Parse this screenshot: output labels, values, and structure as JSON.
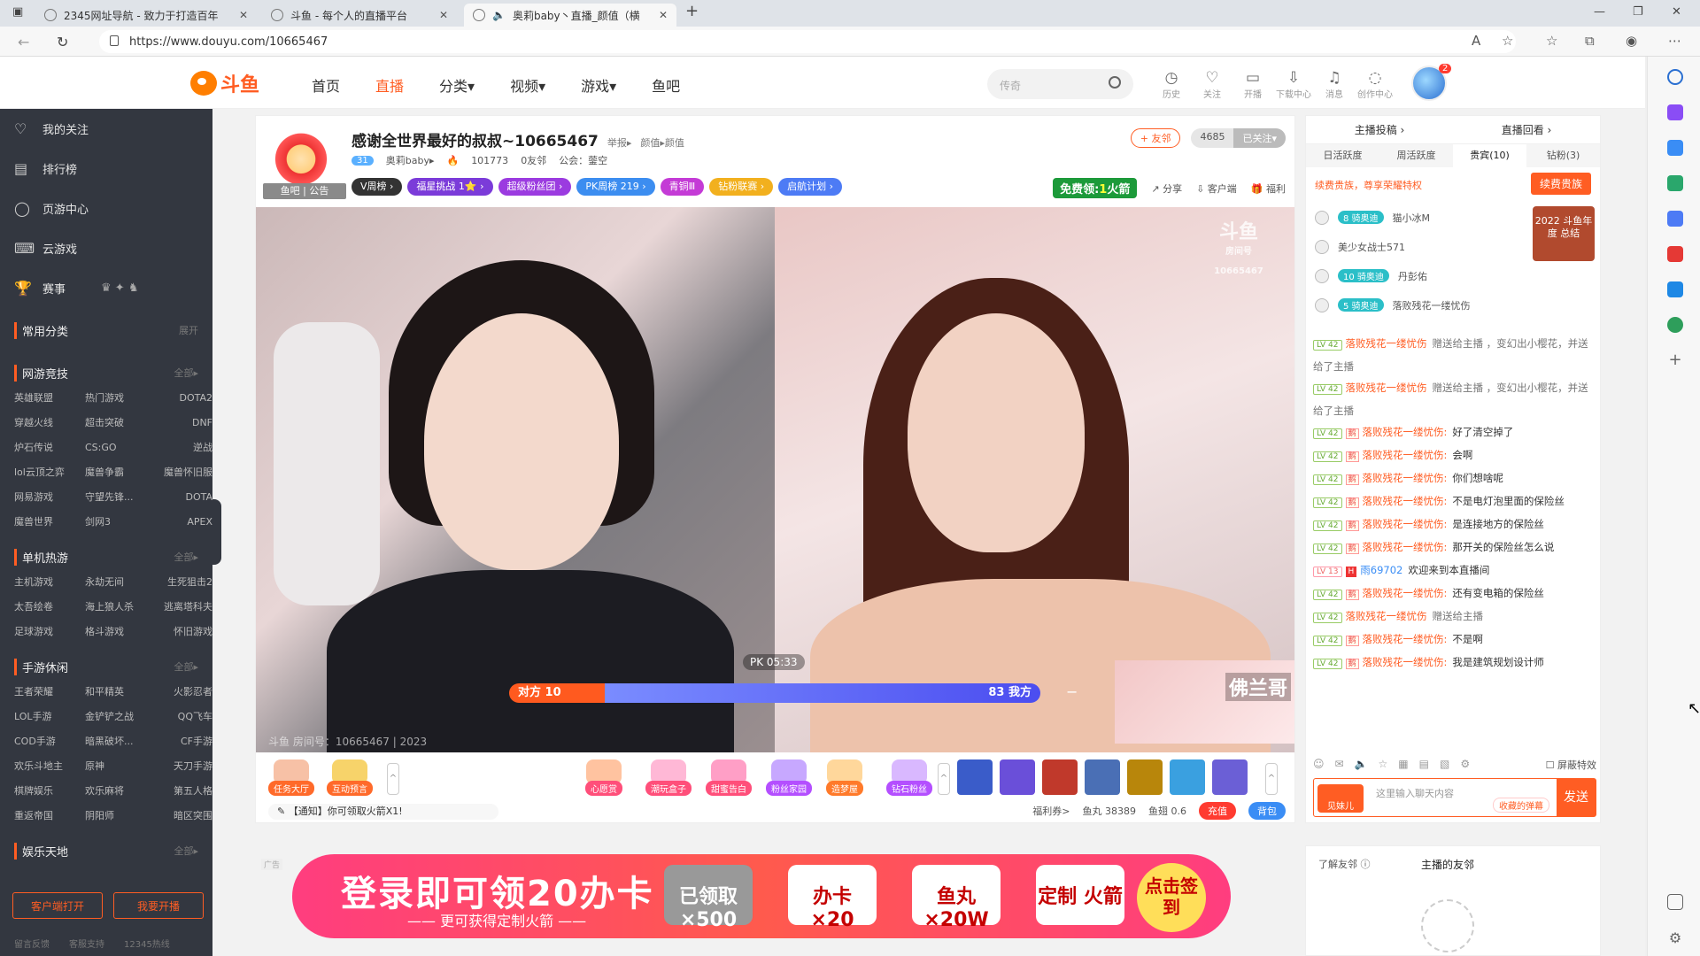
{
  "browser": {
    "tabs": [
      {
        "title": "2345网址导航 - 致力于打造百年",
        "active": false
      },
      {
        "title": "斗鱼 - 每个人的直播平台",
        "active": false
      },
      {
        "title": "奥莉baby丶直播_颜值（横",
        "active": true
      }
    ],
    "url": "https://www.douyu.com/10665467"
  },
  "header": {
    "logo_text": "斗鱼",
    "nav": [
      "首页",
      "直播",
      "分类▾",
      "视频▾",
      "游戏▾",
      "鱼吧"
    ],
    "nav_active": 1,
    "search_placeholder": "传奇",
    "icons": [
      {
        "icon": "history-icon",
        "label": "历史"
      },
      {
        "icon": "heart-icon",
        "label": "关注"
      },
      {
        "icon": "camera-icon",
        "label": "开播"
      },
      {
        "icon": "download-icon",
        "label": "下载中心"
      },
      {
        "icon": "bell-icon",
        "label": "消息"
      },
      {
        "icon": "bulb-icon",
        "label": "创作中心"
      }
    ],
    "avatar_badge": "2"
  },
  "sidebar": {
    "items": [
      {
        "icon": "heart-icon",
        "label": "我的关注"
      },
      {
        "icon": "rank-icon",
        "label": "排行榜"
      },
      {
        "icon": "game-center-icon",
        "label": "页游中心"
      },
      {
        "icon": "cloud-game-icon",
        "label": "云游戏"
      },
      {
        "icon": "trophy-icon",
        "label": "赛事"
      }
    ],
    "common": {
      "title": "常用分类",
      "more": "展开"
    },
    "sections": [
      {
        "title": "网游竞技",
        "more": "全部▸",
        "games": [
          "英雄联盟",
          "热门游戏",
          "DOTA2",
          "穿越火线",
          "超击突破",
          "DNF",
          "炉石传说",
          "CS:GO",
          "逆战",
          "lol云顶之弈",
          "魔兽争霸",
          "魔兽怀旧服",
          "网易游戏",
          "守望先锋...",
          "DOTA",
          "魔兽世界",
          "剑网3",
          "APEX"
        ]
      },
      {
        "title": "单机热游",
        "more": "全部▸",
        "games": [
          "主机游戏",
          "永劫无间",
          "生死狙击2",
          "太吾绘卷",
          "海上狼人杀",
          "逃离塔科夫",
          "足球游戏",
          "格斗游戏",
          "怀旧游戏"
        ]
      },
      {
        "title": "手游休闲",
        "more": "全部▸",
        "games": [
          "王者荣耀",
          "和平精英",
          "火影忍者",
          "LOL手游",
          "金铲铲之战",
          "QQ飞车",
          "COD手游",
          "暗黑破坏...",
          "CF手游",
          "欢乐斗地主",
          "原神",
          "天刀手游",
          "棋牌娱乐",
          "欢乐麻将",
          "第五人格",
          "重返帝国",
          "阴阳师",
          "暗区突围"
        ]
      },
      {
        "title": "娱乐天地",
        "more": "全部▸",
        "games": []
      }
    ],
    "buttons": [
      "客户端打开",
      "我要开播"
    ],
    "footer": [
      "留言反馈",
      "客服支持",
      "12345热线"
    ]
  },
  "room": {
    "avatar_label": "鱼吧 | 公告",
    "title": "感谢全世界最好的叔叔~10665467",
    "report": "举报▸",
    "category": "颜值▸颜值",
    "level": "31",
    "anchor": "奥莉baby▸",
    "hot": "101773",
    "neighbors": "0友邻",
    "guild": "公会：蓥空",
    "tags": [
      {
        "text": "V周榜 ›",
        "color": "#333333"
      },
      {
        "text": "福星挑战 1⭐ ›",
        "color": "#7b3bd9"
      },
      {
        "text": "超级粉丝团 ›",
        "color": "#9b3be0"
      },
      {
        "text": "PK周榜 219 ›",
        "color": "#3c8df0"
      },
      {
        "text": "青铜Ⅲ",
        "color": "#c43bd6"
      },
      {
        "text": "钻粉联赛 ›",
        "color": "#f2b01e"
      },
      {
        "text": "启航计划 ›",
        "color": "#4d7bf5"
      }
    ],
    "fan_btn": "+ 友邻",
    "follow_count": "4685",
    "followed": "已关注▾",
    "free_label": "免费领:",
    "free_num": "1",
    "free_unit": "火箭",
    "share": "分享",
    "client": "客户端",
    "welfare": "福利"
  },
  "video": {
    "watermark_main": "斗鱼",
    "watermark_sub": "房间号",
    "watermark_id": "10665467",
    "pk_time": "PK 05:33",
    "pk_left": "对方 10",
    "pk_right": "83 我方",
    "pk_minus": "−",
    "overlay_name": "佛兰哥",
    "room_no": "斗鱼 房间号：10665467 | 2023"
  },
  "gifts": {
    "left": [
      {
        "label": "任务大厅",
        "color": "#ff6a2a"
      },
      {
        "label": "互动预言",
        "color": "#ff6a2a"
      }
    ],
    "right": [
      {
        "label": "心愿赏",
        "color": "#ff4f7a"
      },
      {
        "label": "潮玩盒子",
        "color": "#ff4f7a"
      },
      {
        "label": "甜蜜告白",
        "color": "#ff4f7a"
      },
      {
        "label": "粉丝家园",
        "color": "#b44fff"
      },
      {
        "label": "造梦屋",
        "color": "#ff7a2a"
      },
      {
        "label": "钻石粉丝",
        "color": "#b44fff"
      }
    ],
    "notice": "【通知】你可领取火箭X1!",
    "ticket": "福利券>",
    "fish_ball": "鱼丸 38389",
    "fish_fin": "鱼翅 0.6",
    "recharge": "充值",
    "bag": "背包"
  },
  "banner": {
    "title": "登录即可领20办卡",
    "subtitle": "—— 更可获得定制火箭 ——",
    "cards": [
      "已领取 ×500",
      "办卡 ×20",
      "鱼丸 ×20W",
      "定制 火箭"
    ],
    "sign": "点击签到",
    "ad": "广告"
  },
  "chat": {
    "top": [
      "主播投稿 ›",
      "直播回看 ›"
    ],
    "tabs": [
      "日活跃度",
      "周活跃度",
      "贵宾(10)",
      "钻粉(3)"
    ],
    "active_tab": 2,
    "renew_text": "续费贵族，尊享荣耀特权",
    "renew_btn": "续费贵族",
    "year_end": "2022 斗鱼年度 总结",
    "vips": [
      {
        "badge": "8 骑奥迪",
        "name": "猫小冰M"
      },
      {
        "badge": "",
        "name": "美少女战士571"
      },
      {
        "badge": "10 骑奥迪",
        "name": "丹彭佑"
      },
      {
        "badge": "5 骑奥迪",
        "name": "落败残花一缕忧伤"
      }
    ],
    "messages": [
      {
        "lv": "LV 42",
        "user": "落败残花一缕忧伤",
        "text": "赠送给主播  ，变幻出小樱花，并送给了主播",
        "gift": true
      },
      {
        "lv": "LV 42",
        "user": "落败残花一缕忧伤",
        "text": "赠送给主播  ，变幻出小樱花，并送给了主播",
        "gift": true
      },
      {
        "lv": "LV 42",
        "user": "落败残花一缕忧伤:",
        "text": "好了清空掉了",
        "gift": false
      },
      {
        "lv": "LV 42",
        "user": "落败残花一缕忧伤:",
        "text": "会啊",
        "gift": false
      },
      {
        "lv": "LV 42",
        "user": "落败残花一缕忧伤:",
        "text": "你们想啥呢",
        "gift": false
      },
      {
        "lv": "LV 42",
        "user": "落败残花一缕忧伤:",
        "text": "不是电灯泡里面的保险丝",
        "gift": false
      },
      {
        "lv": "LV 42",
        "user": "落败残花一缕忧伤:",
        "text": "是连接地方的保险丝",
        "gift": false
      },
      {
        "lv": "LV 42",
        "user": "落败残花一缕忧伤:",
        "text": "那开关的保险丝怎么说",
        "gift": false
      },
      {
        "lv": "LV 13",
        "user": "雨69702",
        "text": "欢迎来到本直播间",
        "gift": false,
        "blue": true
      },
      {
        "lv": "LV 42",
        "user": "落败残花一缕忧伤:",
        "text": "还有变电箱的保险丝",
        "gift": false
      },
      {
        "lv": "LV 42",
        "user": "落败残花一缕忧伤",
        "text": "赠送给主播",
        "gift": true
      },
      {
        "lv": "LV 42",
        "user": "落败残花一缕忧伤:",
        "text": "不是啊",
        "gift": false
      },
      {
        "lv": "LV 42",
        "user": "落败残花一缕忧伤:",
        "text": "我是建筑规划设计师",
        "gift": false
      }
    ],
    "shield": "屏蔽特效",
    "input_placeholder": "这里输入聊天内容",
    "input_badge": "见妹儿",
    "barrage": "收藏的弹幕",
    "send": "发送"
  },
  "friend": {
    "learn": "了解友邻 ⓘ",
    "title": "主播的友邻"
  }
}
